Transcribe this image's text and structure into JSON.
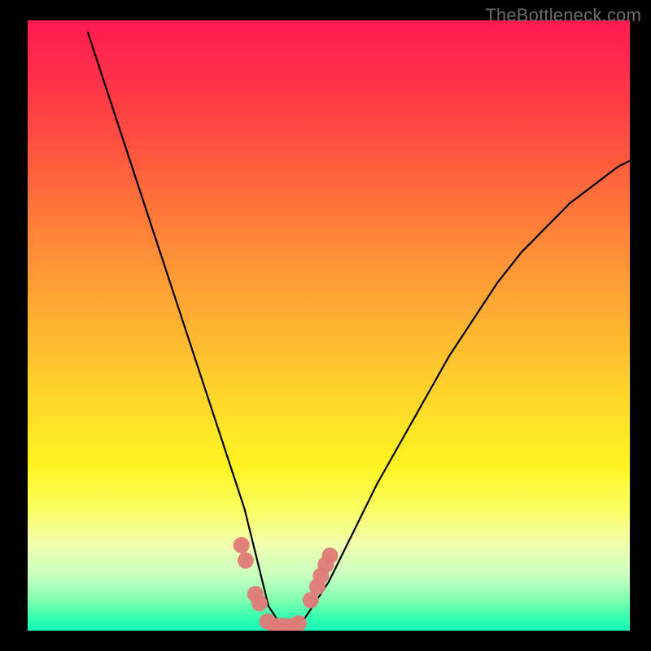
{
  "watermark": "TheBottleneck.com",
  "chart_data": {
    "type": "line",
    "title": "",
    "xlabel": "",
    "ylabel": "",
    "xlim": [
      0,
      100
    ],
    "ylim": [
      0,
      100
    ],
    "grid": false,
    "series": [
      {
        "name": "bottleneck-curve",
        "x": [
          10,
          14,
          18,
          22,
          26,
          30,
          34,
          36,
          38,
          40,
          42,
          44,
          46,
          50,
          54,
          58,
          62,
          66,
          70,
          74,
          78,
          82,
          86,
          90,
          94,
          98,
          100
        ],
        "values": [
          98,
          86,
          74,
          62,
          50,
          38,
          26,
          20,
          12,
          4,
          1,
          1,
          2,
          8,
          16,
          24,
          31,
          38,
          45,
          51,
          57,
          62,
          66,
          70,
          73,
          76,
          77
        ]
      },
      {
        "name": "valley-markers",
        "x": [
          35.5,
          36.2,
          37.8,
          38.5,
          39.8,
          41.0,
          42.5,
          44.0,
          45.0,
          47.0,
          48.1,
          48.7,
          49.5,
          50.2
        ],
        "values": [
          14.0,
          11.5,
          6.0,
          4.5,
          1.5,
          0.8,
          0.8,
          0.8,
          1.2,
          5.0,
          7.2,
          9.0,
          10.8,
          12.3
        ]
      }
    ],
    "gradient_stops": [
      {
        "pos": 0,
        "color": "#ff1a50"
      },
      {
        "pos": 9,
        "color": "#ff2f4a"
      },
      {
        "pos": 20,
        "color": "#ff5040"
      },
      {
        "pos": 32,
        "color": "#ff7a3a"
      },
      {
        "pos": 43,
        "color": "#ff9e36"
      },
      {
        "pos": 55,
        "color": "#ffc230"
      },
      {
        "pos": 65,
        "color": "#ffe028"
      },
      {
        "pos": 73,
        "color": "#fff322"
      },
      {
        "pos": 80,
        "color": "#fbff60"
      },
      {
        "pos": 86,
        "color": "#f0ffb0"
      },
      {
        "pos": 91,
        "color": "#c8ffc0"
      },
      {
        "pos": 95,
        "color": "#7fffb0"
      },
      {
        "pos": 98,
        "color": "#32ffb0"
      },
      {
        "pos": 100,
        "color": "#14f5b8"
      }
    ]
  }
}
